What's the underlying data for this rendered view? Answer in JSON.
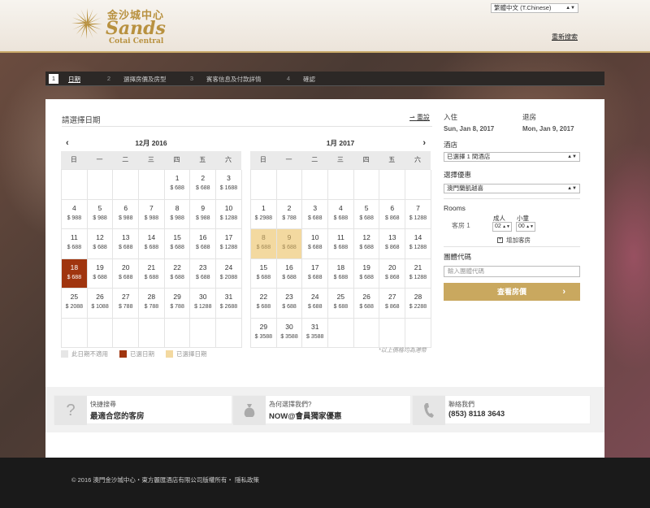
{
  "header": {
    "logo_cn": "金沙城中心",
    "logo_en": "Sands",
    "logo_sub": "Cotai Central",
    "language": "繁體中文 (T.Chinese)",
    "refresh_link": "重新搜索"
  },
  "steps": [
    {
      "num": "1",
      "label": "日期"
    },
    {
      "num": "2",
      "label": "選擇房價及房型"
    },
    {
      "num": "3",
      "label": "賓客信息及付款詳情"
    },
    {
      "num": "4",
      "label": "確認"
    }
  ],
  "calendar_section": {
    "title": "請選擇日期",
    "reset": "重設",
    "weekdays": [
      "日",
      "一",
      "二",
      "三",
      "四",
      "五",
      "六"
    ],
    "months": [
      {
        "label": "12月 2016",
        "leading_blanks": 4,
        "days": [
          {
            "d": "1",
            "p": "$ 688"
          },
          {
            "d": "2",
            "p": "$ 688"
          },
          {
            "d": "3",
            "p": "$ 1688"
          },
          {
            "d": "4",
            "p": "$ 988"
          },
          {
            "d": "5",
            "p": "$ 988"
          },
          {
            "d": "6",
            "p": "$ 988"
          },
          {
            "d": "7",
            "p": "$ 988"
          },
          {
            "d": "8",
            "p": "$ 988"
          },
          {
            "d": "9",
            "p": "$ 988"
          },
          {
            "d": "10",
            "p": "$ 1288"
          },
          {
            "d": "11",
            "p": "$ 688"
          },
          {
            "d": "12",
            "p": "$ 688"
          },
          {
            "d": "13",
            "p": "$ 688"
          },
          {
            "d": "14",
            "p": "$ 688"
          },
          {
            "d": "15",
            "p": "$ 688"
          },
          {
            "d": "16",
            "p": "$ 688"
          },
          {
            "d": "17",
            "p": "$ 1288"
          },
          {
            "d": "18",
            "p": "$ 688",
            "state": "sel"
          },
          {
            "d": "19",
            "p": "$ 688"
          },
          {
            "d": "20",
            "p": "$ 688"
          },
          {
            "d": "21",
            "p": "$ 688"
          },
          {
            "d": "22",
            "p": "$ 688"
          },
          {
            "d": "23",
            "p": "$ 688"
          },
          {
            "d": "24",
            "p": "$ 2088"
          },
          {
            "d": "25",
            "p": "$ 2088"
          },
          {
            "d": "26",
            "p": "$ 1088"
          },
          {
            "d": "27",
            "p": "$ 788"
          },
          {
            "d": "28",
            "p": "$ 788"
          },
          {
            "d": "29",
            "p": "$ 788"
          },
          {
            "d": "30",
            "p": "$ 1288"
          },
          {
            "d": "31",
            "p": "$ 2688"
          }
        ],
        "trailing_blanks": 7
      },
      {
        "label": "1月 2017",
        "leading_blanks": 7,
        "days": [
          {
            "d": "1",
            "p": "$ 2988"
          },
          {
            "d": "2",
            "p": "$ 788"
          },
          {
            "d": "3",
            "p": "$ 688"
          },
          {
            "d": "4",
            "p": "$ 688"
          },
          {
            "d": "5",
            "p": "$ 688"
          },
          {
            "d": "6",
            "p": "$ 868"
          },
          {
            "d": "7",
            "p": "$ 1288"
          },
          {
            "d": "8",
            "p": "$ 688",
            "state": "range"
          },
          {
            "d": "9",
            "p": "$ 688",
            "state": "range"
          },
          {
            "d": "10",
            "p": "$ 688"
          },
          {
            "d": "11",
            "p": "$ 688"
          },
          {
            "d": "12",
            "p": "$ 688"
          },
          {
            "d": "13",
            "p": "$ 868"
          },
          {
            "d": "14",
            "p": "$ 1288"
          },
          {
            "d": "15",
            "p": "$ 688"
          },
          {
            "d": "16",
            "p": "$ 688"
          },
          {
            "d": "17",
            "p": "$ 688"
          },
          {
            "d": "18",
            "p": "$ 688"
          },
          {
            "d": "19",
            "p": "$ 688"
          },
          {
            "d": "20",
            "p": "$ 868"
          },
          {
            "d": "21",
            "p": "$ 1288"
          },
          {
            "d": "22",
            "p": "$ 688"
          },
          {
            "d": "23",
            "p": "$ 688"
          },
          {
            "d": "24",
            "p": "$ 688"
          },
          {
            "d": "25",
            "p": "$ 688"
          },
          {
            "d": "26",
            "p": "$ 688"
          },
          {
            "d": "27",
            "p": "$ 868"
          },
          {
            "d": "28",
            "p": "$ 2288"
          },
          {
            "d": "29",
            "p": "$ 3588"
          },
          {
            "d": "30",
            "p": "$ 3588"
          },
          {
            "d": "31",
            "p": "$ 3588"
          }
        ],
        "trailing_blanks": 4
      }
    ],
    "legend": [
      {
        "label": "此日期不適用",
        "color": "#e6e6e6"
      },
      {
        "label": "已選日期",
        "color": "#a0350f"
      },
      {
        "label": "已選擇日期",
        "color": "#f3d9a0"
      }
    ],
    "note": "*以上價格均為港幣"
  },
  "form": {
    "checkin_label": "入住",
    "checkin_value": "Sun, Jan 8, 2017",
    "checkout_label": "退房",
    "checkout_value": "Mon, Jan 9, 2017",
    "hotel_label": "酒店",
    "hotel_value": "已選擇 1 間酒店",
    "offer_label": "選擇優惠",
    "offer_value": "澳門蘭凱越喜",
    "rooms_label": "Rooms",
    "room_name": "客房 1",
    "adults_label": "成人",
    "adults_value": "02",
    "children_label": "小童",
    "children_value": "00",
    "add_room": "增加客房",
    "group_label": "團體代碼",
    "group_placeholder": "輸入團體代碼",
    "cta": "查看房價"
  },
  "info": [
    {
      "t1": "快捷搜尋",
      "t2": "最適合您的客房",
      "icon": "?"
    },
    {
      "t1": "為何選擇我們?",
      "t2": "NOW@會員獨家優惠",
      "icon": "bag"
    },
    {
      "t1": "聯絡我們",
      "t2": "(853) 8118 3643",
      "icon": "phone"
    }
  ],
  "footer": {
    "text": "© 2016 澳門金沙城中心・東方麗匯酒店有限公司版權所有・ 隱私政策"
  }
}
